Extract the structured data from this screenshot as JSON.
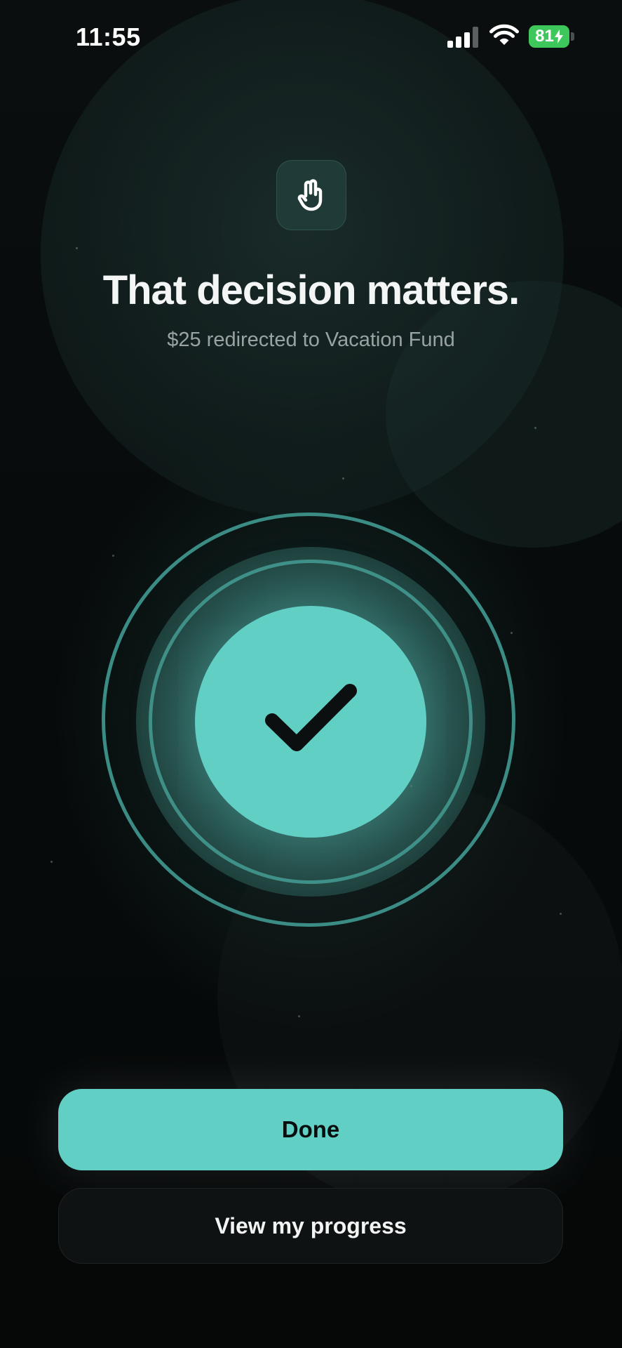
{
  "status_bar": {
    "time": "11:55",
    "battery_level": "81"
  },
  "header": {
    "icon": "raised-hand-icon",
    "title": "That decision matters.",
    "subtitle": "$25 redirected to Vacation Fund"
  },
  "confirmation": {
    "icon": "checkmark-icon"
  },
  "actions": {
    "done_label": "Done",
    "progress_label": "View my progress"
  },
  "colors": {
    "accent": "#62cfc5",
    "background": "#060808",
    "ring": "#3a8c84",
    "battery": "#3ec85c"
  }
}
